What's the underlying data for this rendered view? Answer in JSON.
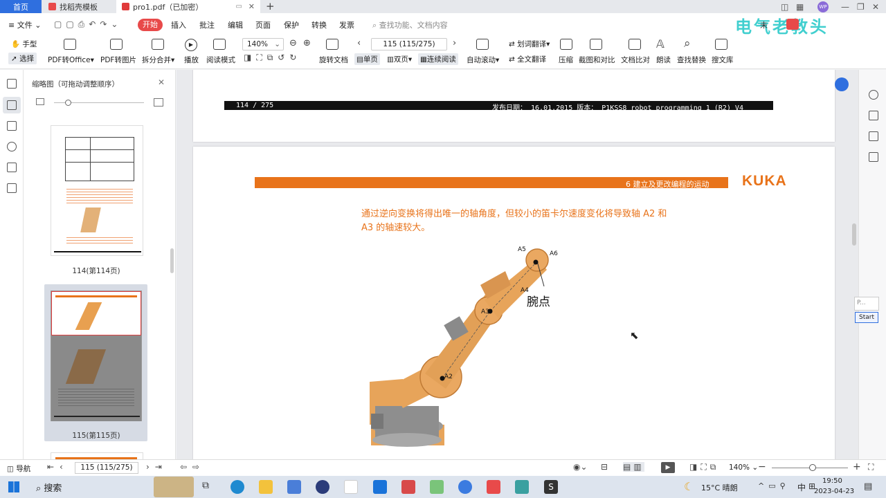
{
  "tabs": {
    "home": "首页",
    "template": "找稻壳模板",
    "document": "pro1.pdf（已加密）",
    "add": "+"
  },
  "watermark": "电气老教头",
  "menu": {
    "file": "文件",
    "start": "开始",
    "insert": "插入",
    "annotate": "批注",
    "edit": "编辑",
    "page": "页面",
    "protect": "保护",
    "convert": "转换",
    "share": "发票",
    "search_placeholder": "查找功能、文档内容",
    "right_partial": "未"
  },
  "toolbar": {
    "hand": "手型",
    "select": "选择",
    "pdf_to_office": "PDF转Office",
    "pdf_to_image": "PDF转图片",
    "split_merge": "拆分合并",
    "play": "播放",
    "read_mode": "阅读模式",
    "zoom": "140%",
    "rotate_doc": "旋转文档",
    "page_field": "115 (115/275)",
    "single": "单页",
    "double": "双页",
    "continuous": "连续阅读",
    "auto_scroll": "自动滚动",
    "word_translate": "划词翻译",
    "full_translate": "全文翻译",
    "compress": "压缩",
    "screenshot_compare": "截图和对比",
    "doc_compare": "文档比对",
    "read_aloud": "朗读",
    "find_replace": "查找替换",
    "search_lib": "搜文库"
  },
  "thumbnails": {
    "title": "缩略图（可拖动调整顺序）",
    "pages": [
      {
        "label": "114(第114页)"
      },
      {
        "label": "115(第115页)"
      }
    ]
  },
  "document": {
    "prev_footer_left": "114 / 275",
    "prev_footer_right": "发布日期： 16.01.2015 版本： P1KSS8 robot programming 1 (R2) V4",
    "header_chapter": "6 建立及更改编程的运动",
    "brand": "KUKA",
    "body_line1": "通过逆向变换将得出唯一的轴角度，但较小的笛卡尔速度变化将导致轴 A2 和",
    "body_line2": "A3 的轴速较大。",
    "fig_labels": {
      "a2": "A2",
      "a3": "A3",
      "a4": "A4",
      "a5": "A5",
      "a6": "A6",
      "wrist": "腕点"
    }
  },
  "side_widget": {
    "p": "P...",
    "start": "Start"
  },
  "statusbar": {
    "nav": "导航",
    "page_field": "115 (115/275)",
    "zoom": "140%",
    "minus": "−",
    "plus": "+"
  },
  "taskbar": {
    "search": "搜索",
    "weather": "15°C 晴朗",
    "ime": "中",
    "time": "19:50",
    "date": "2023-04-23"
  },
  "colors": {
    "accent_blue": "#2f6fdf",
    "kuka_orange": "#e8731a",
    "start_red": "#e84a4a"
  }
}
